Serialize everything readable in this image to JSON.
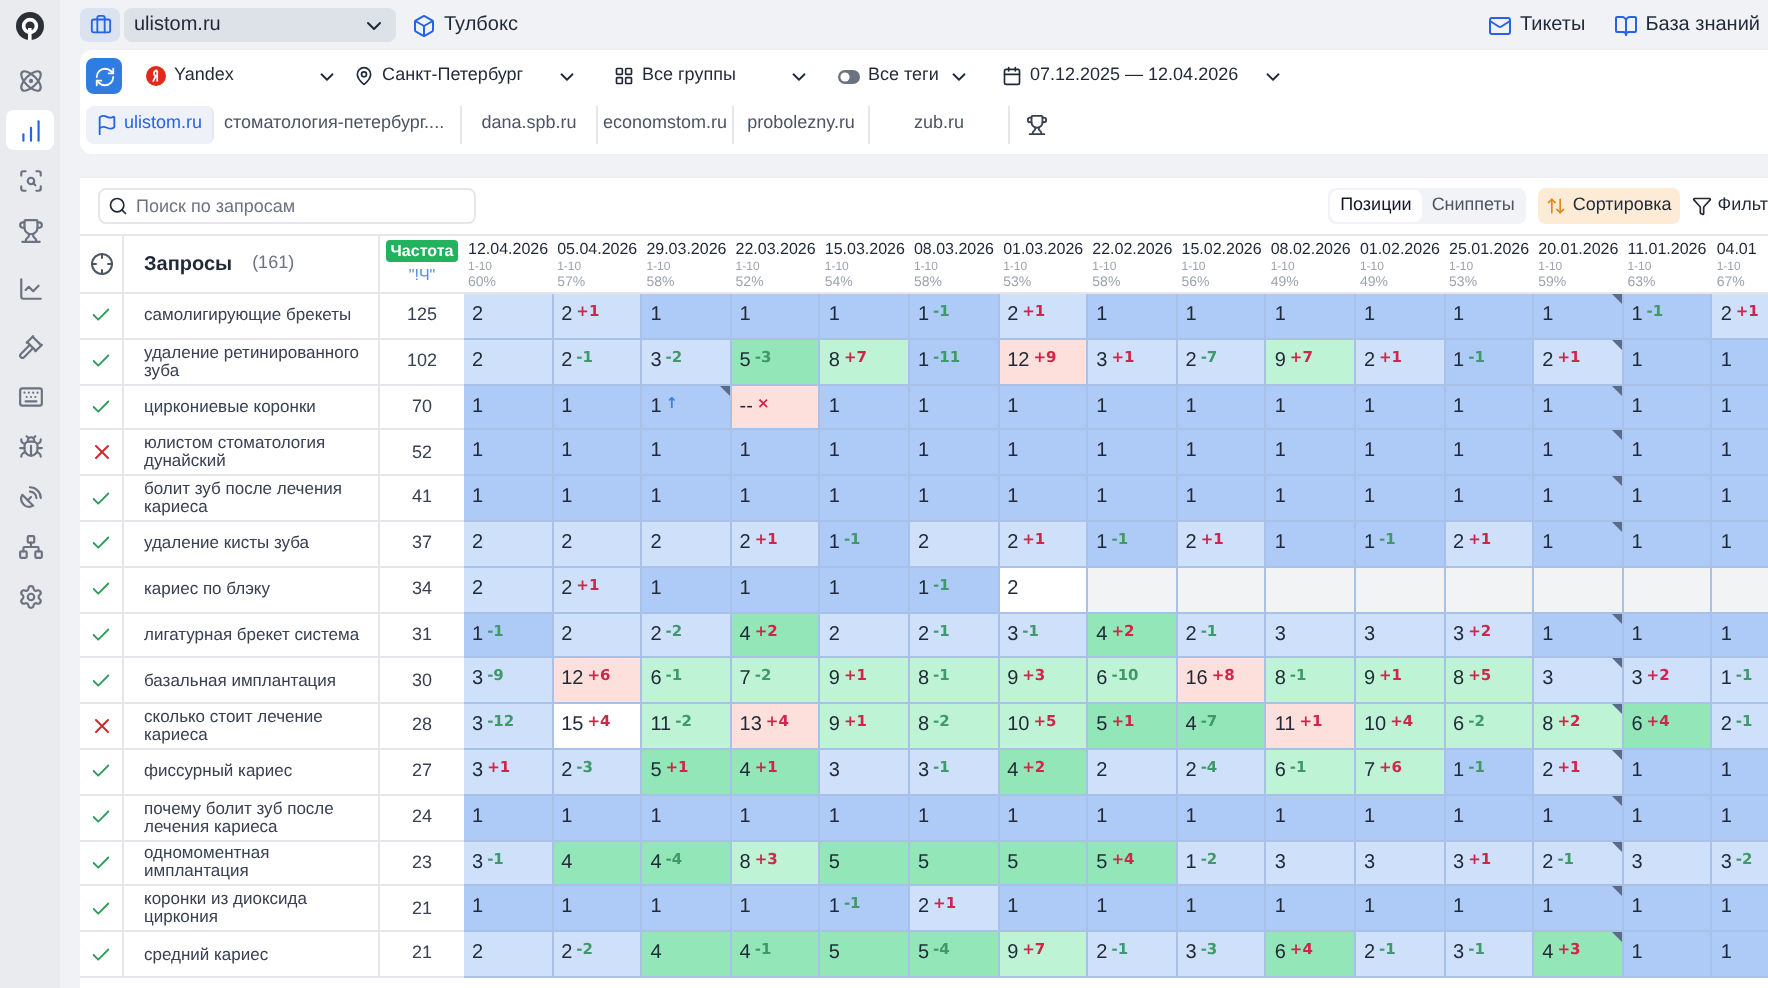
{
  "sidebar": {
    "items": [
      {
        "kind": "orbit",
        "selected": false
      },
      {
        "kind": "bars",
        "selected": true
      },
      {
        "kind": "scan",
        "selected": false
      },
      {
        "kind": "trophy",
        "selected": false
      },
      {
        "kind": "chart",
        "selected": false
      },
      {
        "kind": "gavel",
        "selected": false
      },
      {
        "kind": "keyboard",
        "selected": false
      },
      {
        "kind": "bug",
        "selected": false
      },
      {
        "kind": "dish",
        "selected": false
      },
      {
        "kind": "network",
        "selected": false
      },
      {
        "kind": "settings",
        "selected": false
      }
    ]
  },
  "topbar": {
    "project": "ulistom.ru",
    "toolbox": "Тулбокс",
    "tickets": "Тикеты",
    "knowledge": "База знаний"
  },
  "filters": {
    "engine": "Yandex",
    "region": "Санкт-Петербург",
    "groups": "Все группы",
    "tags": "Все теги",
    "dates": "07.12.2025 — 12.04.2026"
  },
  "domains": [
    {
      "label": "ulistom.ru",
      "selected": true
    },
    {
      "label": "стоматология-петербург....",
      "selected": false
    },
    {
      "label": "dana.spb.ru",
      "selected": false
    },
    {
      "label": "economstom.ru",
      "selected": false
    },
    {
      "label": "probolezny.ru",
      "selected": false
    },
    {
      "label": "zub.ru",
      "selected": false
    }
  ],
  "toolbar": {
    "search_placeholder": "Поиск по запросам",
    "views": [
      {
        "label": "Позиции",
        "selected": true
      },
      {
        "label": "Сниппеты",
        "selected": false
      }
    ],
    "sort": "Сортировка",
    "filter": "Фильт"
  },
  "table": {
    "query_header": "Запросы",
    "query_count": "(161)",
    "freq_badge": "Частота",
    "freq_type": "\"!Ч\"",
    "columns": [
      {
        "date": "12.04.2026",
        "range": "1-10",
        "share": "60%"
      },
      {
        "date": "05.04.2026",
        "range": "1-10",
        "share": "57%"
      },
      {
        "date": "29.03.2026",
        "range": "1-10",
        "share": "58%"
      },
      {
        "date": "22.03.2026",
        "range": "1-10",
        "share": "52%"
      },
      {
        "date": "15.03.2026",
        "range": "1-10",
        "share": "54%"
      },
      {
        "date": "08.03.2026",
        "range": "1-10",
        "share": "58%"
      },
      {
        "date": "01.03.2026",
        "range": "1-10",
        "share": "53%"
      },
      {
        "date": "22.02.2026",
        "range": "1-10",
        "share": "58%"
      },
      {
        "date": "15.02.2026",
        "range": "1-10",
        "share": "56%"
      },
      {
        "date": "08.02.2026",
        "range": "1-10",
        "share": "49%"
      },
      {
        "date": "01.02.2026",
        "range": "1-10",
        "share": "49%"
      },
      {
        "date": "25.01.2026",
        "range": "1-10",
        "share": "53%"
      },
      {
        "date": "20.01.2026",
        "range": "1-10",
        "share": "59%"
      },
      {
        "date": "11.01.2026",
        "range": "1-10",
        "share": "63%"
      },
      {
        "date": "04.01",
        "range": "1-10",
        "share": "67%"
      }
    ],
    "rows": [
      {
        "ok": true,
        "query": "самолигирующие брекеты",
        "freq": "125",
        "cells": [
          {
            "value": "2",
            "color": "#cfe0fb"
          },
          {
            "value": "2",
            "delta": {
              "text": "+1",
              "color": "#d0264a"
            },
            "color": "#cfe0fb"
          },
          {
            "value": "1",
            "color": "#aecaf6"
          },
          {
            "value": "1",
            "color": "#aecaf6"
          },
          {
            "value": "1",
            "color": "#aecaf6"
          },
          {
            "value": "1",
            "delta": {
              "text": "-1",
              "color": "#3f9a6a"
            },
            "color": "#aecaf6"
          },
          {
            "value": "2",
            "delta": {
              "text": "+1",
              "color": "#d0264a"
            },
            "color": "#cfe0fb"
          },
          {
            "value": "1",
            "color": "#aecaf6"
          },
          {
            "value": "1",
            "color": "#aecaf6"
          },
          {
            "value": "1",
            "color": "#aecaf6"
          },
          {
            "value": "1",
            "color": "#aecaf6"
          },
          {
            "value": "1",
            "color": "#aecaf6"
          },
          {
            "value": "1",
            "color": "#aecaf6",
            "note": true
          },
          {
            "value": "1",
            "delta": {
              "text": "-1",
              "color": "#3f9a6a"
            },
            "color": "#aecaf6"
          },
          {
            "value": "2",
            "delta": {
              "text": "+1",
              "color": "#d0264a"
            },
            "color": "#cfe0fb"
          }
        ]
      },
      {
        "ok": true,
        "query": "удаление ретинированного зуба",
        "freq": "102",
        "cells": [
          {
            "value": "2",
            "color": "#cfe0fb"
          },
          {
            "value": "2",
            "delta": {
              "text": "-1",
              "color": "#3f9a6a"
            },
            "color": "#cfe0fb"
          },
          {
            "value": "3",
            "delta": {
              "text": "-2",
              "color": "#3f9a6a"
            },
            "color": "#cfe0fb"
          },
          {
            "value": "5",
            "delta": {
              "text": "-3",
              "color": "#3f9a6a"
            },
            "color": "#92e6b8"
          },
          {
            "value": "8",
            "delta": {
              "text": "+7",
              "color": "#d0264a"
            },
            "color": "#bff3d5"
          },
          {
            "value": "1",
            "delta": {
              "text": "-11",
              "color": "#3f9a6a"
            },
            "color": "#aecaf6"
          },
          {
            "value": "12",
            "delta": {
              "text": "+9",
              "color": "#d0264a"
            },
            "color": "#fde0dc"
          },
          {
            "value": "3",
            "delta": {
              "text": "+1",
              "color": "#d0264a"
            },
            "color": "#cfe0fb"
          },
          {
            "value": "2",
            "delta": {
              "text": "-7",
              "color": "#3f9a6a"
            },
            "color": "#cfe0fb"
          },
          {
            "value": "9",
            "delta": {
              "text": "+7",
              "color": "#d0264a"
            },
            "color": "#bff3d5"
          },
          {
            "value": "2",
            "delta": {
              "text": "+1",
              "color": "#d0264a"
            },
            "color": "#cfe0fb"
          },
          {
            "value": "1",
            "delta": {
              "text": "-1",
              "color": "#3f9a6a"
            },
            "color": "#aecaf6"
          },
          {
            "value": "2",
            "delta": {
              "text": "+1",
              "color": "#d0264a"
            },
            "color": "#cfe0fb",
            "note": true
          },
          {
            "value": "1",
            "color": "#aecaf6"
          },
          {
            "value": "1",
            "color": "#aecaf6"
          }
        ]
      },
      {
        "ok": true,
        "query": "циркониевые коронки",
        "freq": "70",
        "cells": [
          {
            "value": "1",
            "color": "#aecaf6"
          },
          {
            "value": "1",
            "color": "#aecaf6"
          },
          {
            "value": "1",
            "delta": {
              "text": "↑",
              "color": "#3b7fe0"
            },
            "color": "#aecaf6",
            "note": true
          },
          {
            "value": "--",
            "delta": {
              "text": "×",
              "color": "#d0264a"
            },
            "color": "#fde0dc"
          },
          {
            "value": "1",
            "color": "#aecaf6"
          },
          {
            "value": "1",
            "color": "#aecaf6"
          },
          {
            "value": "1",
            "color": "#aecaf6"
          },
          {
            "value": "1",
            "color": "#aecaf6"
          },
          {
            "value": "1",
            "color": "#aecaf6"
          },
          {
            "value": "1",
            "color": "#aecaf6"
          },
          {
            "value": "1",
            "color": "#aecaf6"
          },
          {
            "value": "1",
            "color": "#aecaf6"
          },
          {
            "value": "1",
            "color": "#aecaf6",
            "note": true
          },
          {
            "value": "1",
            "color": "#aecaf6"
          },
          {
            "value": "1",
            "color": "#aecaf6"
          }
        ]
      },
      {
        "ok": false,
        "query": "юлистом стоматология дунайский",
        "freq": "52",
        "cells": [
          {
            "value": "1",
            "color": "#aecaf6"
          },
          {
            "value": "1",
            "color": "#aecaf6"
          },
          {
            "value": "1",
            "color": "#aecaf6"
          },
          {
            "value": "1",
            "color": "#aecaf6"
          },
          {
            "value": "1",
            "color": "#aecaf6"
          },
          {
            "value": "1",
            "color": "#aecaf6"
          },
          {
            "value": "1",
            "color": "#aecaf6"
          },
          {
            "value": "1",
            "color": "#aecaf6"
          },
          {
            "value": "1",
            "color": "#aecaf6"
          },
          {
            "value": "1",
            "color": "#aecaf6"
          },
          {
            "value": "1",
            "color": "#aecaf6"
          },
          {
            "value": "1",
            "color": "#aecaf6"
          },
          {
            "value": "1",
            "color": "#aecaf6",
            "note": true
          },
          {
            "value": "1",
            "color": "#aecaf6"
          },
          {
            "value": "1",
            "color": "#aecaf6"
          }
        ]
      },
      {
        "ok": true,
        "query": "болит зуб после лечения кариеса",
        "freq": "41",
        "cells": [
          {
            "value": "1",
            "color": "#aecaf6"
          },
          {
            "value": "1",
            "color": "#aecaf6"
          },
          {
            "value": "1",
            "color": "#aecaf6"
          },
          {
            "value": "1",
            "color": "#aecaf6"
          },
          {
            "value": "1",
            "color": "#aecaf6"
          },
          {
            "value": "1",
            "color": "#aecaf6"
          },
          {
            "value": "1",
            "color": "#aecaf6"
          },
          {
            "value": "1",
            "color": "#aecaf6"
          },
          {
            "value": "1",
            "color": "#aecaf6"
          },
          {
            "value": "1",
            "color": "#aecaf6"
          },
          {
            "value": "1",
            "color": "#aecaf6"
          },
          {
            "value": "1",
            "color": "#aecaf6"
          },
          {
            "value": "1",
            "color": "#aecaf6",
            "note": true
          },
          {
            "value": "1",
            "color": "#aecaf6"
          },
          {
            "value": "1",
            "color": "#aecaf6"
          }
        ]
      },
      {
        "ok": true,
        "query": "удаление кисты зуба",
        "freq": "37",
        "cells": [
          {
            "value": "2",
            "color": "#cfe0fb"
          },
          {
            "value": "2",
            "color": "#cfe0fb"
          },
          {
            "value": "2",
            "color": "#cfe0fb"
          },
          {
            "value": "2",
            "delta": {
              "text": "+1",
              "color": "#d0264a"
            },
            "color": "#cfe0fb"
          },
          {
            "value": "1",
            "delta": {
              "text": "-1",
              "color": "#3f9a6a"
            },
            "color": "#aecaf6"
          },
          {
            "value": "2",
            "color": "#cfe0fb"
          },
          {
            "value": "2",
            "delta": {
              "text": "+1",
              "color": "#d0264a"
            },
            "color": "#cfe0fb"
          },
          {
            "value": "1",
            "delta": {
              "text": "-1",
              "color": "#3f9a6a"
            },
            "color": "#aecaf6"
          },
          {
            "value": "2",
            "delta": {
              "text": "+1",
              "color": "#d0264a"
            },
            "color": "#cfe0fb"
          },
          {
            "value": "1",
            "color": "#aecaf6"
          },
          {
            "value": "1",
            "delta": {
              "text": "-1",
              "color": "#3f9a6a"
            },
            "color": "#aecaf6"
          },
          {
            "value": "2",
            "delta": {
              "text": "+1",
              "color": "#d0264a"
            },
            "color": "#cfe0fb"
          },
          {
            "value": "1",
            "color": "#aecaf6",
            "note": true
          },
          {
            "value": "1",
            "color": "#aecaf6"
          },
          {
            "value": "1",
            "color": "#aecaf6"
          }
        ]
      },
      {
        "ok": true,
        "query": "кариес по блэку",
        "freq": "34",
        "cells": [
          {
            "value": "2",
            "color": "#cfe0fb"
          },
          {
            "value": "2",
            "delta": {
              "text": "+1",
              "color": "#d0264a"
            },
            "color": "#cfe0fb"
          },
          {
            "value": "1",
            "color": "#aecaf6"
          },
          {
            "value": "1",
            "color": "#aecaf6"
          },
          {
            "value": "1",
            "color": "#aecaf6"
          },
          {
            "value": "1",
            "delta": {
              "text": "-1",
              "color": "#3f9a6a"
            },
            "color": "#aecaf6"
          },
          {
            "value": "2",
            "color": "#ffffff"
          },
          {
            "color": "#f2f3f5"
          },
          {
            "color": "#f2f3f5"
          },
          {
            "color": "#f2f3f5"
          },
          {
            "color": "#f2f3f5"
          },
          {
            "color": "#f2f3f5"
          },
          {
            "color": "#f2f3f5"
          },
          {
            "color": "#f2f3f5"
          },
          {
            "color": "#f2f3f5"
          }
        ]
      },
      {
        "ok": true,
        "query": "лигатурная брекет система",
        "freq": "31",
        "cells": [
          {
            "value": "1",
            "delta": {
              "text": "-1",
              "color": "#3f9a6a"
            },
            "color": "#aecaf6"
          },
          {
            "value": "2",
            "color": "#cfe0fb"
          },
          {
            "value": "2",
            "delta": {
              "text": "-2",
              "color": "#3f9a6a"
            },
            "color": "#cfe0fb"
          },
          {
            "value": "4",
            "delta": {
              "text": "+2",
              "color": "#d0264a"
            },
            "color": "#92e6b8"
          },
          {
            "value": "2",
            "color": "#cfe0fb"
          },
          {
            "value": "2",
            "delta": {
              "text": "-1",
              "color": "#3f9a6a"
            },
            "color": "#cfe0fb"
          },
          {
            "value": "3",
            "delta": {
              "text": "-1",
              "color": "#3f9a6a"
            },
            "color": "#cfe0fb"
          },
          {
            "value": "4",
            "delta": {
              "text": "+2",
              "color": "#d0264a"
            },
            "color": "#92e6b8"
          },
          {
            "value": "2",
            "delta": {
              "text": "-1",
              "color": "#3f9a6a"
            },
            "color": "#cfe0fb"
          },
          {
            "value": "3",
            "color": "#cfe0fb"
          },
          {
            "value": "3",
            "color": "#cfe0fb"
          },
          {
            "value": "3",
            "delta": {
              "text": "+2",
              "color": "#d0264a"
            },
            "color": "#cfe0fb"
          },
          {
            "value": "1",
            "color": "#aecaf6",
            "note": true
          },
          {
            "value": "1",
            "color": "#aecaf6"
          },
          {
            "value": "1",
            "color": "#aecaf6"
          }
        ]
      },
      {
        "ok": true,
        "query": "базальная имплантация",
        "freq": "30",
        "cells": [
          {
            "value": "3",
            "delta": {
              "text": "-9",
              "color": "#3f9a6a"
            },
            "color": "#cfe0fb"
          },
          {
            "value": "12",
            "delta": {
              "text": "+6",
              "color": "#d0264a"
            },
            "color": "#fde0dc"
          },
          {
            "value": "6",
            "delta": {
              "text": "-1",
              "color": "#3f9a6a"
            },
            "color": "#bff3d5"
          },
          {
            "value": "7",
            "delta": {
              "text": "-2",
              "color": "#3f9a6a"
            },
            "color": "#bff3d5"
          },
          {
            "value": "9",
            "delta": {
              "text": "+1",
              "color": "#d0264a"
            },
            "color": "#bff3d5"
          },
          {
            "value": "8",
            "delta": {
              "text": "-1",
              "color": "#3f9a6a"
            },
            "color": "#bff3d5"
          },
          {
            "value": "9",
            "delta": {
              "text": "+3",
              "color": "#d0264a"
            },
            "color": "#bff3d5"
          },
          {
            "value": "6",
            "delta": {
              "text": "-10",
              "color": "#3f9a6a"
            },
            "color": "#bff3d5"
          },
          {
            "value": "16",
            "delta": {
              "text": "+8",
              "color": "#d0264a"
            },
            "color": "#fde0dc"
          },
          {
            "value": "8",
            "delta": {
              "text": "-1",
              "color": "#3f9a6a"
            },
            "color": "#bff3d5"
          },
          {
            "value": "9",
            "delta": {
              "text": "+1",
              "color": "#d0264a"
            },
            "color": "#bff3d5"
          },
          {
            "value": "8",
            "delta": {
              "text": "+5",
              "color": "#d0264a"
            },
            "color": "#bff3d5"
          },
          {
            "value": "3",
            "color": "#cfe0fb",
            "note": true
          },
          {
            "value": "3",
            "delta": {
              "text": "+2",
              "color": "#d0264a"
            },
            "color": "#cfe0fb"
          },
          {
            "value": "1",
            "delta": {
              "text": "-1",
              "color": "#3f9a6a"
            },
            "color": "#cfe0fb"
          }
        ]
      },
      {
        "ok": false,
        "query": "сколько стоит лечение кариеса",
        "freq": "28",
        "cells": [
          {
            "value": "3",
            "delta": {
              "text": "-12",
              "color": "#3f9a6a"
            },
            "color": "#cfe0fb"
          },
          {
            "value": "15",
            "delta": {
              "text": "+4",
              "color": "#d0264a"
            },
            "color": "#ffffff"
          },
          {
            "value": "11",
            "delta": {
              "text": "-2",
              "color": "#3f9a6a"
            },
            "color": "#bff3d5"
          },
          {
            "value": "13",
            "delta": {
              "text": "+4",
              "color": "#d0264a"
            },
            "color": "#fde0dc"
          },
          {
            "value": "9",
            "delta": {
              "text": "+1",
              "color": "#d0264a"
            },
            "color": "#bff3d5"
          },
          {
            "value": "8",
            "delta": {
              "text": "-2",
              "color": "#3f9a6a"
            },
            "color": "#bff3d5"
          },
          {
            "value": "10",
            "delta": {
              "text": "+5",
              "color": "#d0264a"
            },
            "color": "#bff3d5"
          },
          {
            "value": "5",
            "delta": {
              "text": "+1",
              "color": "#d0264a"
            },
            "color": "#92e6b8"
          },
          {
            "value": "4",
            "delta": {
              "text": "-7",
              "color": "#3f9a6a"
            },
            "color": "#92e6b8"
          },
          {
            "value": "11",
            "delta": {
              "text": "+1",
              "color": "#d0264a"
            },
            "color": "#fde0dc"
          },
          {
            "value": "10",
            "delta": {
              "text": "+4",
              "color": "#d0264a"
            },
            "color": "#bff3d5"
          },
          {
            "value": "6",
            "delta": {
              "text": "-2",
              "color": "#3f9a6a"
            },
            "color": "#bff3d5"
          },
          {
            "value": "8",
            "delta": {
              "text": "+2",
              "color": "#d0264a"
            },
            "color": "#bff3d5",
            "note": true
          },
          {
            "value": "6",
            "delta": {
              "text": "+4",
              "color": "#d0264a"
            },
            "color": "#92e6b8"
          },
          {
            "value": "2",
            "delta": {
              "text": "-1",
              "color": "#3f9a6a"
            },
            "color": "#cfe0fb"
          }
        ]
      },
      {
        "ok": true,
        "query": "фиссурный кариес",
        "freq": "27",
        "cells": [
          {
            "value": "3",
            "delta": {
              "text": "+1",
              "color": "#d0264a"
            },
            "color": "#cfe0fb"
          },
          {
            "value": "2",
            "delta": {
              "text": "-3",
              "color": "#3f9a6a"
            },
            "color": "#cfe0fb"
          },
          {
            "value": "5",
            "delta": {
              "text": "+1",
              "color": "#d0264a"
            },
            "color": "#92e6b8"
          },
          {
            "value": "4",
            "delta": {
              "text": "+1",
              "color": "#d0264a"
            },
            "color": "#92e6b8"
          },
          {
            "value": "3",
            "color": "#cfe0fb"
          },
          {
            "value": "3",
            "delta": {
              "text": "-1",
              "color": "#3f9a6a"
            },
            "color": "#cfe0fb"
          },
          {
            "value": "4",
            "delta": {
              "text": "+2",
              "color": "#d0264a"
            },
            "color": "#92e6b8"
          },
          {
            "value": "2",
            "color": "#cfe0fb"
          },
          {
            "value": "2",
            "delta": {
              "text": "-4",
              "color": "#3f9a6a"
            },
            "color": "#cfe0fb"
          },
          {
            "value": "6",
            "delta": {
              "text": "-1",
              "color": "#3f9a6a"
            },
            "color": "#bff3d5"
          },
          {
            "value": "7",
            "delta": {
              "text": "+6",
              "color": "#d0264a"
            },
            "color": "#bff3d5"
          },
          {
            "value": "1",
            "delta": {
              "text": "-1",
              "color": "#3f9a6a"
            },
            "color": "#aecaf6"
          },
          {
            "value": "2",
            "delta": {
              "text": "+1",
              "color": "#d0264a"
            },
            "color": "#cfe0fb",
            "note": true
          },
          {
            "value": "1",
            "color": "#aecaf6"
          },
          {
            "value": "1",
            "color": "#aecaf6"
          }
        ]
      },
      {
        "ok": true,
        "query": "почему болит зуб после лечения кариеса",
        "freq": "24",
        "cells": [
          {
            "value": "1",
            "color": "#aecaf6"
          },
          {
            "value": "1",
            "color": "#aecaf6"
          },
          {
            "value": "1",
            "color": "#aecaf6"
          },
          {
            "value": "1",
            "color": "#aecaf6"
          },
          {
            "value": "1",
            "color": "#aecaf6"
          },
          {
            "value": "1",
            "color": "#aecaf6"
          },
          {
            "value": "1",
            "color": "#aecaf6"
          },
          {
            "value": "1",
            "color": "#aecaf6"
          },
          {
            "value": "1",
            "color": "#aecaf6"
          },
          {
            "value": "1",
            "color": "#aecaf6"
          },
          {
            "value": "1",
            "color": "#aecaf6"
          },
          {
            "value": "1",
            "color": "#aecaf6"
          },
          {
            "value": "1",
            "color": "#aecaf6",
            "note": true
          },
          {
            "value": "1",
            "color": "#aecaf6"
          },
          {
            "value": "1",
            "color": "#aecaf6"
          }
        ]
      },
      {
        "ok": true,
        "query": "одномоментная имплантация",
        "freq": "23",
        "cells": [
          {
            "value": "3",
            "delta": {
              "text": "-1",
              "color": "#3f9a6a"
            },
            "color": "#cfe0fb"
          },
          {
            "value": "4",
            "color": "#92e6b8"
          },
          {
            "value": "4",
            "delta": {
              "text": "-4",
              "color": "#3f9a6a"
            },
            "color": "#92e6b8"
          },
          {
            "value": "8",
            "delta": {
              "text": "+3",
              "color": "#d0264a"
            },
            "color": "#bff3d5"
          },
          {
            "value": "5",
            "color": "#92e6b8"
          },
          {
            "value": "5",
            "color": "#92e6b8"
          },
          {
            "value": "5",
            "color": "#92e6b8"
          },
          {
            "value": "5",
            "delta": {
              "text": "+4",
              "color": "#d0264a"
            },
            "color": "#92e6b8"
          },
          {
            "value": "1",
            "delta": {
              "text": "-2",
              "color": "#3f9a6a"
            },
            "color": "#cfe0fb"
          },
          {
            "value": "3",
            "color": "#cfe0fb"
          },
          {
            "value": "3",
            "color": "#cfe0fb"
          },
          {
            "value": "3",
            "delta": {
              "text": "+1",
              "color": "#d0264a"
            },
            "color": "#cfe0fb"
          },
          {
            "value": "2",
            "delta": {
              "text": "-1",
              "color": "#3f9a6a"
            },
            "color": "#cfe0fb",
            "note": true
          },
          {
            "value": "3",
            "color": "#cfe0fb"
          },
          {
            "value": "3",
            "delta": {
              "text": "-2",
              "color": "#3f9a6a"
            },
            "color": "#cfe0fb"
          }
        ]
      },
      {
        "ok": true,
        "query": "коронки из диоксида циркония",
        "freq": "21",
        "cells": [
          {
            "value": "1",
            "color": "#aecaf6"
          },
          {
            "value": "1",
            "color": "#aecaf6"
          },
          {
            "value": "1",
            "color": "#aecaf6"
          },
          {
            "value": "1",
            "color": "#aecaf6"
          },
          {
            "value": "1",
            "delta": {
              "text": "-1",
              "color": "#3f9a6a"
            },
            "color": "#aecaf6"
          },
          {
            "value": "2",
            "delta": {
              "text": "+1",
              "color": "#d0264a"
            },
            "color": "#cfe0fb"
          },
          {
            "value": "1",
            "color": "#aecaf6"
          },
          {
            "value": "1",
            "color": "#aecaf6"
          },
          {
            "value": "1",
            "color": "#aecaf6"
          },
          {
            "value": "1",
            "color": "#aecaf6"
          },
          {
            "value": "1",
            "color": "#aecaf6"
          },
          {
            "value": "1",
            "color": "#aecaf6"
          },
          {
            "value": "1",
            "color": "#aecaf6",
            "note": true
          },
          {
            "value": "1",
            "color": "#aecaf6"
          },
          {
            "value": "1",
            "color": "#aecaf6"
          }
        ]
      },
      {
        "ok": true,
        "query": "средний кариес",
        "freq": "21",
        "cells": [
          {
            "value": "2",
            "color": "#cfe0fb"
          },
          {
            "value": "2",
            "delta": {
              "text": "-2",
              "color": "#3f9a6a"
            },
            "color": "#cfe0fb"
          },
          {
            "value": "4",
            "color": "#92e6b8"
          },
          {
            "value": "4",
            "delta": {
              "text": "-1",
              "color": "#3f9a6a"
            },
            "color": "#92e6b8"
          },
          {
            "value": "5",
            "color": "#92e6b8"
          },
          {
            "value": "5",
            "delta": {
              "text": "-4",
              "color": "#3f9a6a"
            },
            "color": "#92e6b8"
          },
          {
            "value": "9",
            "delta": {
              "text": "+7",
              "color": "#d0264a"
            },
            "color": "#bff3d5"
          },
          {
            "value": "2",
            "delta": {
              "text": "-1",
              "color": "#3f9a6a"
            },
            "color": "#cfe0fb"
          },
          {
            "value": "3",
            "delta": {
              "text": "-3",
              "color": "#3f9a6a"
            },
            "color": "#cfe0fb"
          },
          {
            "value": "6",
            "delta": {
              "text": "+4",
              "color": "#d0264a"
            },
            "color": "#92e6b8"
          },
          {
            "value": "2",
            "delta": {
              "text": "-1",
              "color": "#3f9a6a"
            },
            "color": "#cfe0fb"
          },
          {
            "value": "3",
            "delta": {
              "text": "-1",
              "color": "#3f9a6a"
            },
            "color": "#cfe0fb"
          },
          {
            "value": "4",
            "delta": {
              "text": "+3",
              "color": "#d0264a"
            },
            "color": "#92e6b8",
            "note": true
          },
          {
            "value": "1",
            "color": "#aecaf6"
          },
          {
            "value": "1",
            "color": "#aecaf6"
          }
        ]
      }
    ]
  }
}
